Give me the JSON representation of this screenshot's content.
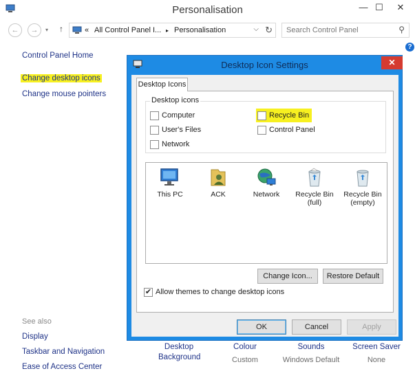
{
  "window": {
    "title": "Personalisation",
    "minimize": "—",
    "maximize": "☐",
    "close": "✕"
  },
  "address": {
    "back": "←",
    "forward": "→",
    "up": "↑",
    "recent": "▾",
    "prefix": "«",
    "crumb1": "All Control Panel I...",
    "sep": "▸",
    "crumb2": "Personalisation",
    "dropdown": "⌵",
    "refresh": "↻",
    "search_placeholder": "Search Control Panel",
    "search_icon": "⚲",
    "help": "?"
  },
  "left_pane": {
    "home": "Control Panel Home",
    "change_icons": "Change desktop icons",
    "change_pointers": "Change mouse pointers",
    "see_also": "See also",
    "display": "Display",
    "taskbar": "Taskbar and Navigation",
    "ease": "Ease of Access Center"
  },
  "bottom": {
    "desktop_bg_1": "Desktop",
    "desktop_bg_2": "Background",
    "colour": "Colour",
    "colour_val": "Custom",
    "sounds": "Sounds",
    "sounds_val": "Windows Default",
    "screensaver": "Screen Saver",
    "screensaver_val": "None"
  },
  "dialog": {
    "title": "Desktop Icon Settings",
    "close": "✕",
    "tab": "Desktop Icons",
    "group_title": "Desktop icons",
    "checkboxes": {
      "computer": {
        "label": "Computer",
        "mark": ""
      },
      "recycle": {
        "label": "Recycle Bin",
        "mark": ""
      },
      "userfiles": {
        "label": "User's Files",
        "mark": ""
      },
      "controlpanel": {
        "label": "Control Panel",
        "mark": ""
      },
      "network": {
        "label": "Network",
        "mark": ""
      }
    },
    "icons": [
      {
        "label": "This PC"
      },
      {
        "label": "ACK"
      },
      {
        "label": "Network"
      },
      {
        "label": "Recycle Bin\n(full)"
      },
      {
        "label": "Recycle Bin\n(empty)"
      }
    ],
    "change_icon": "Change Icon...",
    "restore_default": "Restore Default",
    "allow_themes": {
      "label": "Allow themes to change desktop icons",
      "mark": "✔"
    },
    "ok": "OK",
    "cancel": "Cancel",
    "apply": "Apply"
  },
  "colors": {
    "dialog_frame": "#1e8be4",
    "highlight": "#f7f020",
    "link": "#1e3287",
    "close_red": "#d53b30"
  }
}
